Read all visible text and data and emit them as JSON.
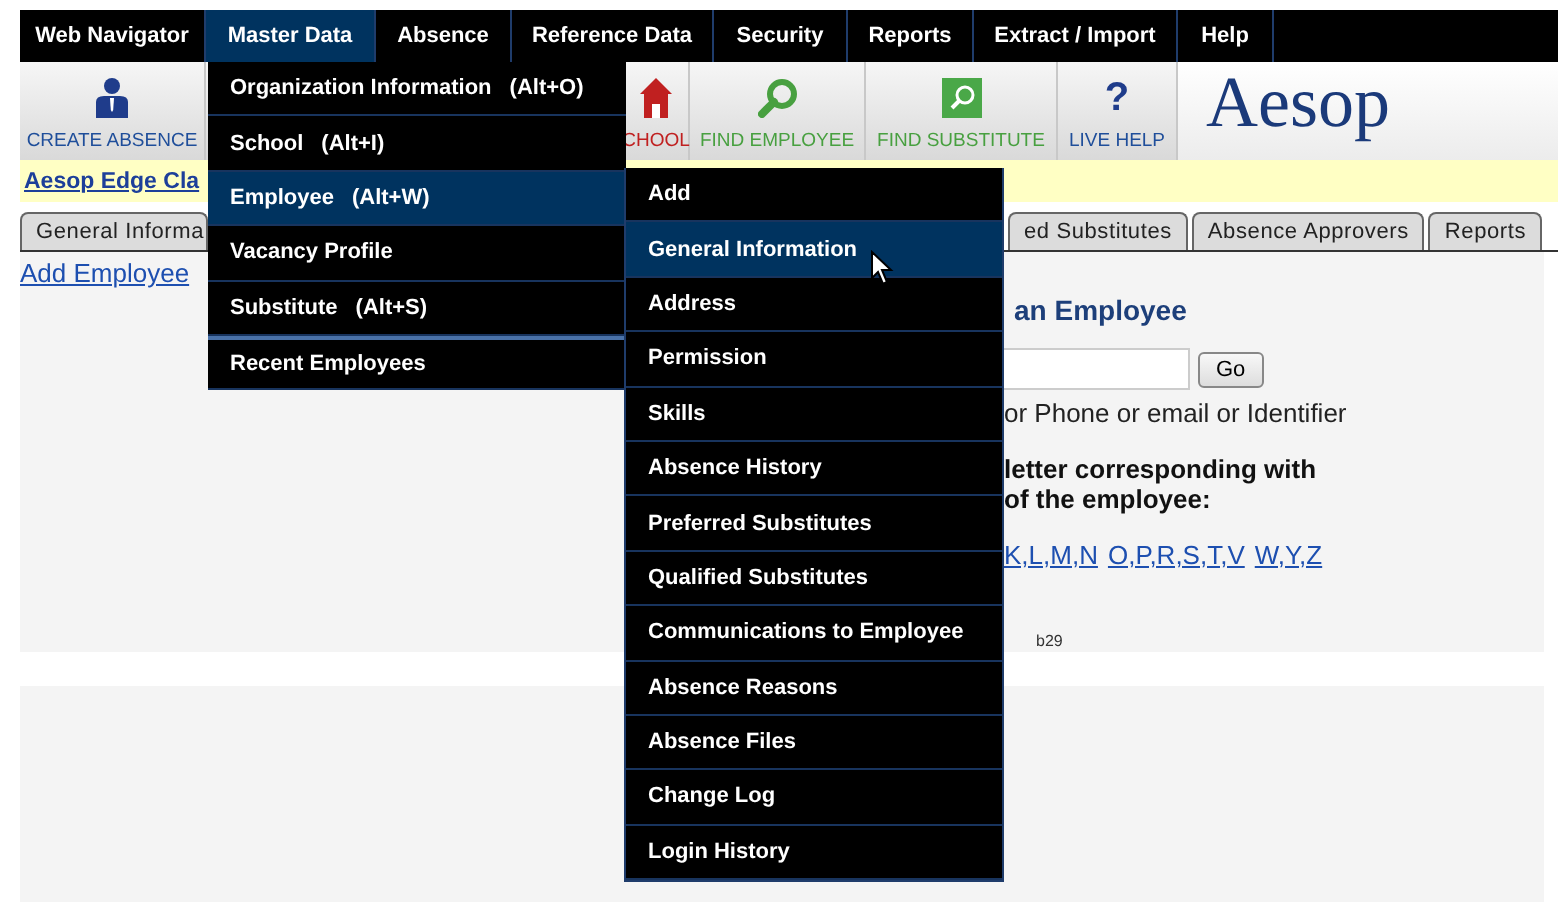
{
  "nav": [
    {
      "label": "Web Navigator",
      "selected": false
    },
    {
      "label": "Master Data",
      "selected": true
    },
    {
      "label": "Absence",
      "selected": false
    },
    {
      "label": "Reference Data",
      "selected": false
    },
    {
      "label": "Security",
      "selected": false
    },
    {
      "label": "Reports",
      "selected": false
    },
    {
      "label": "Extract / Import",
      "selected": false
    },
    {
      "label": "Help",
      "selected": false
    }
  ],
  "toolbar": [
    {
      "kind": "create",
      "label": "CREATE ABSENCE"
    },
    {
      "kind": "school",
      "label": "CHOOL"
    },
    {
      "kind": "find",
      "label": "FIND EMPLOYEE"
    },
    {
      "kind": "findsub",
      "label": "FIND SUBSTITUTE"
    },
    {
      "kind": "help",
      "label": "LIVE HELP",
      "glyph": "?"
    }
  ],
  "logo": "Aesop",
  "breadcrumb": "Aesop Edge Cla",
  "tabs": [
    {
      "label": "General Informa",
      "selected": false
    },
    {
      "label": "ed Substitutes",
      "selected": false
    },
    {
      "label": "Absence Approvers",
      "selected": false
    },
    {
      "label": "Reports",
      "selected": false
    }
  ],
  "content": {
    "add_link": "Add Employee",
    "heading": "an Employee",
    "go_button": "Go",
    "hint": "or Phone or email or Identifier",
    "instruction": [
      "letter corresponding with",
      "of the employee:"
    ],
    "letter_links": [
      "K,L,M,N",
      "O,P,R,S,T,V",
      "W,Y,Z"
    ],
    "code": "b29"
  },
  "master_menu": [
    {
      "label": "Organization Information",
      "shortcut": "(Alt+O)",
      "selected": false,
      "separator_above": false
    },
    {
      "label": "School",
      "shortcut": "(Alt+I)",
      "selected": false,
      "separator_above": false
    },
    {
      "label": "Employee",
      "shortcut": "(Alt+W)",
      "selected": true,
      "separator_above": false
    },
    {
      "label": "Vacancy Profile",
      "selected": false,
      "separator_above": false
    },
    {
      "label": "Substitute",
      "shortcut": "(Alt+S)",
      "selected": false,
      "separator_above": false
    },
    {
      "label": "Recent Employees",
      "selected": false,
      "separator_above": true
    }
  ],
  "employee_submenu": [
    {
      "label": "Add",
      "selected": false
    },
    {
      "label": "General Information",
      "selected": true
    },
    {
      "label": "Address",
      "selected": false
    },
    {
      "label": "Permission",
      "selected": false
    },
    {
      "label": "Skills",
      "selected": false
    },
    {
      "label": "Absence History",
      "selected": false
    },
    {
      "label": "Preferred Substitutes",
      "selected": false
    },
    {
      "label": "Qualified Substitutes",
      "selected": false
    },
    {
      "label": "Communications to Employee",
      "selected": false
    },
    {
      "label": "Absence Reasons",
      "selected": false
    },
    {
      "label": "Absence Files",
      "selected": false
    },
    {
      "label": "Change Log",
      "selected": false
    },
    {
      "label": "Login History",
      "selected": false
    }
  ]
}
